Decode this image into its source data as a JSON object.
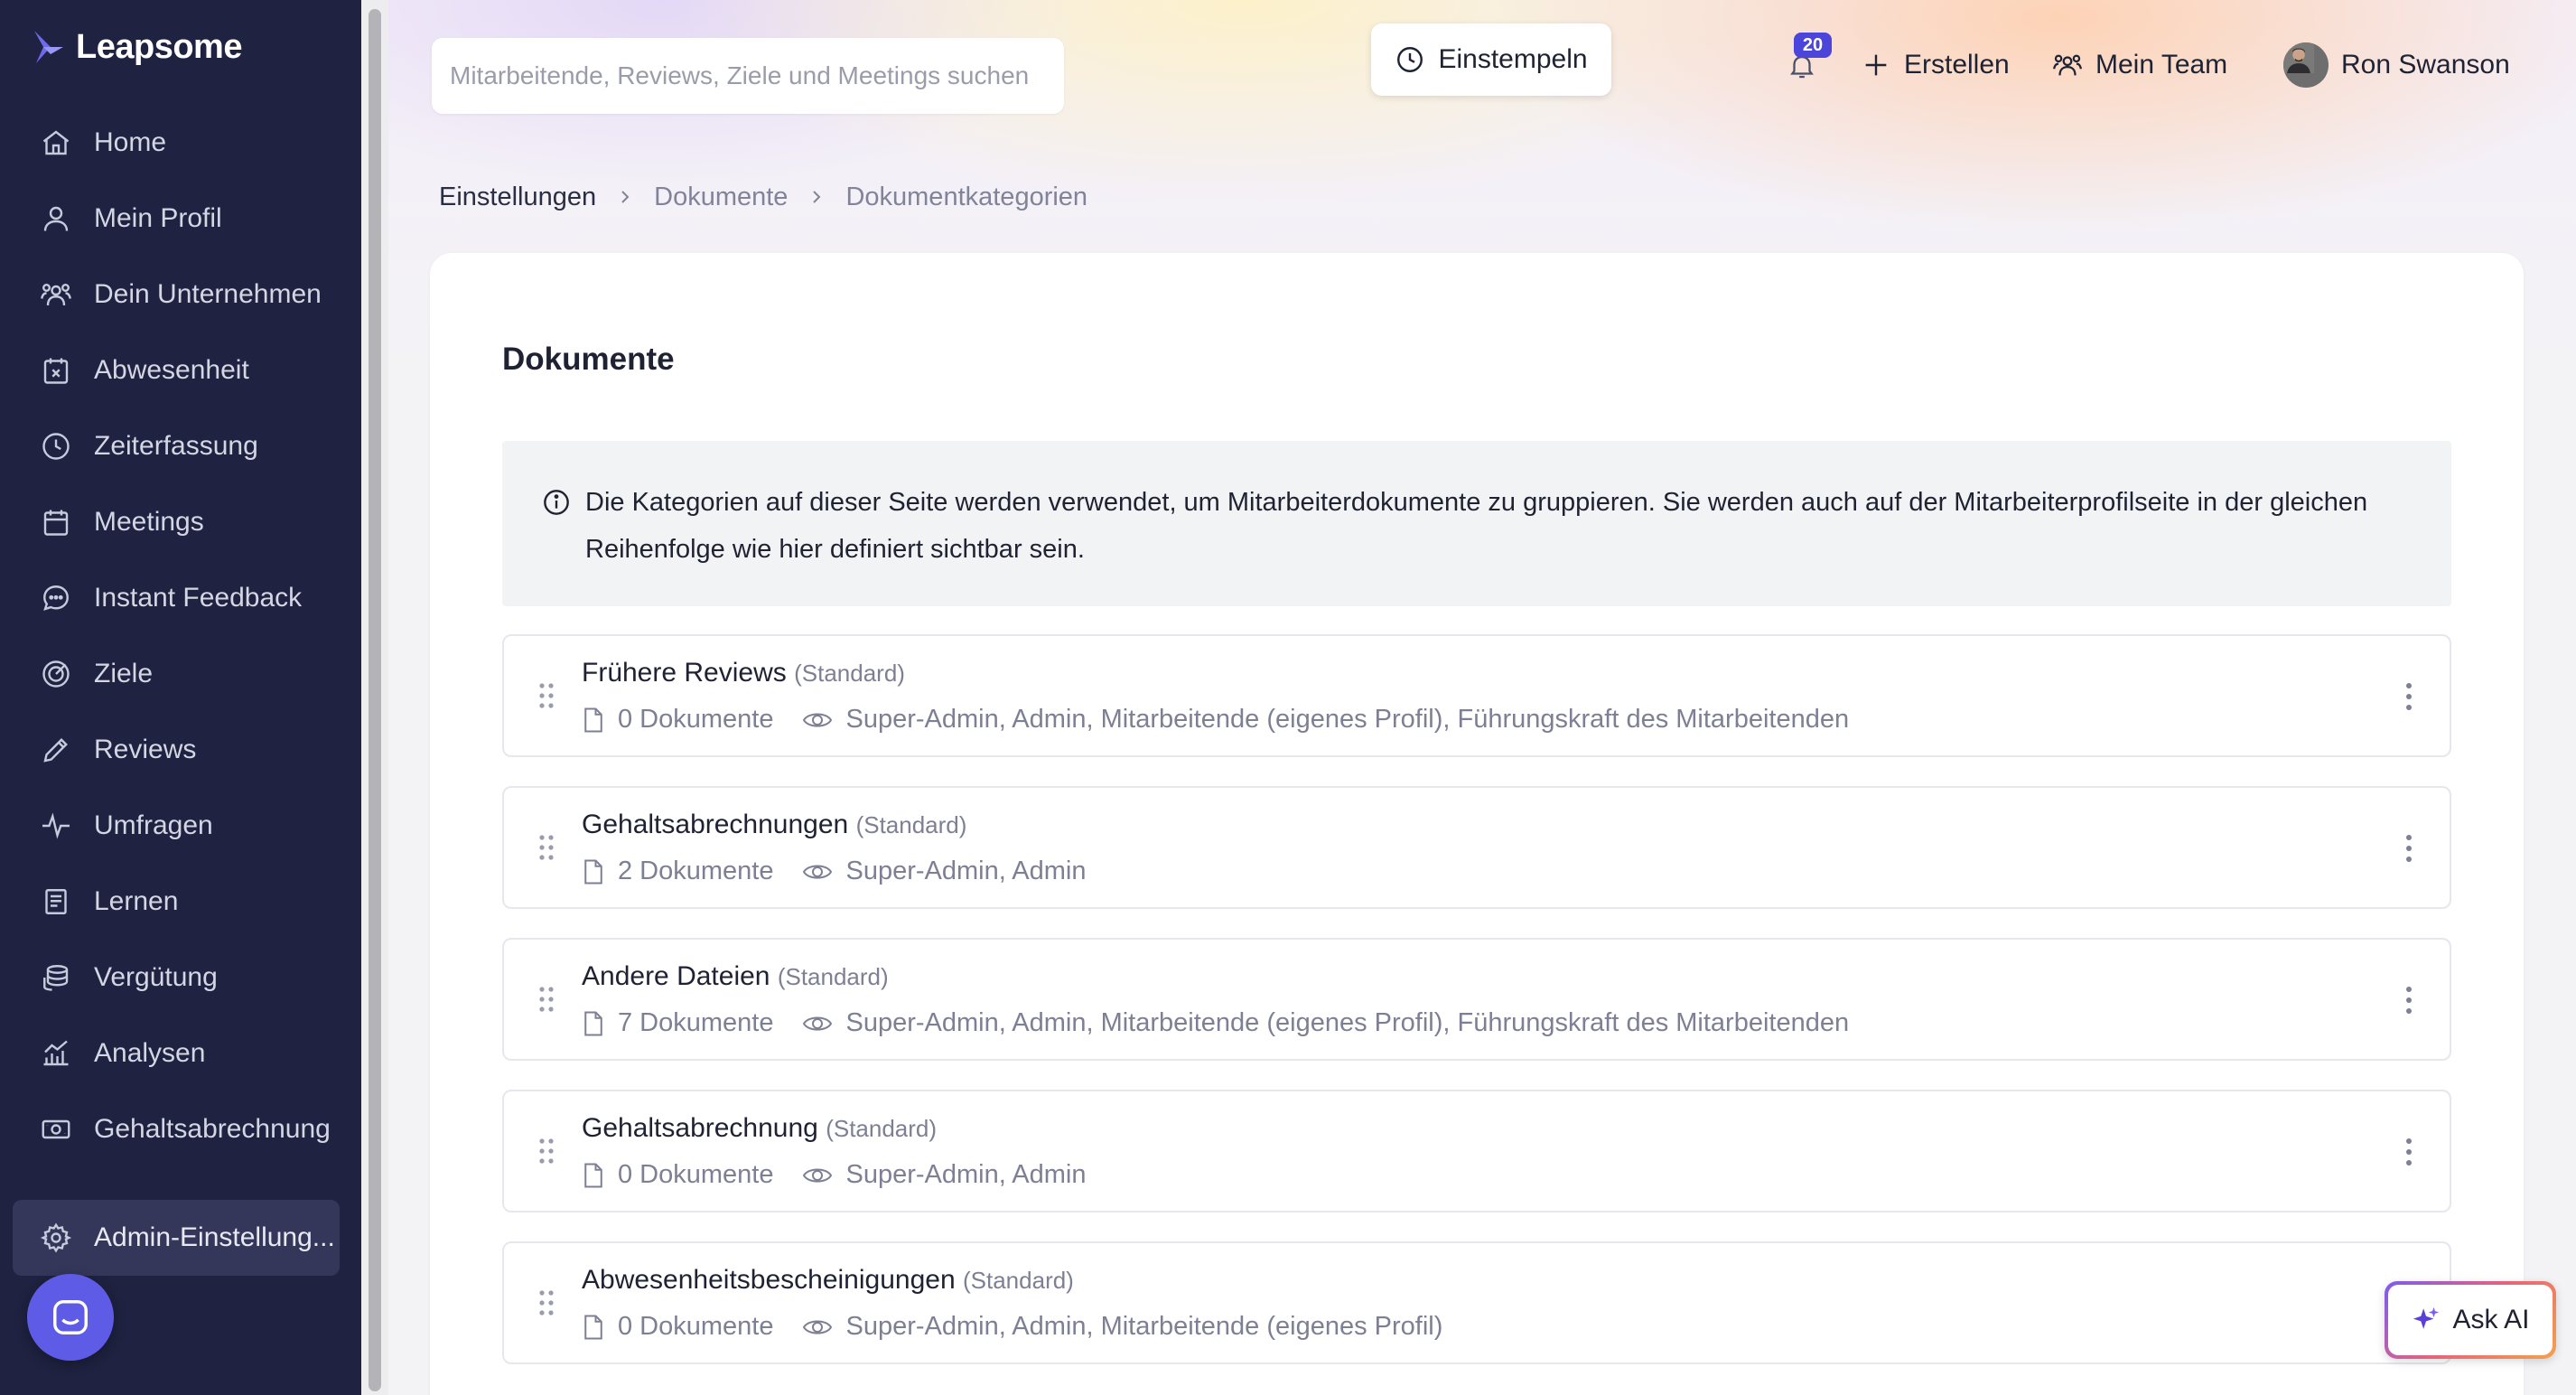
{
  "brand": {
    "name": "Leapsome"
  },
  "sidebar": {
    "items": [
      {
        "label": "Home",
        "icon": "home-icon"
      },
      {
        "label": "Mein Profil",
        "icon": "user-icon"
      },
      {
        "label": "Dein Unternehmen",
        "icon": "users-icon"
      },
      {
        "label": "Abwesenheit",
        "icon": "calendar-x-icon"
      },
      {
        "label": "Zeiterfassung",
        "icon": "clock-icon"
      },
      {
        "label": "Meetings",
        "icon": "calendar-icon"
      },
      {
        "label": "Instant Feedback",
        "icon": "chat-bubble-icon"
      },
      {
        "label": "Ziele",
        "icon": "target-icon"
      },
      {
        "label": "Reviews",
        "icon": "pencil-icon"
      },
      {
        "label": "Umfragen",
        "icon": "pulse-icon"
      },
      {
        "label": "Lernen",
        "icon": "book-icon"
      },
      {
        "label": "Vergütung",
        "icon": "coins-icon"
      },
      {
        "label": "Analysen",
        "icon": "chart-icon"
      },
      {
        "label": "Gehaltsabrechnung",
        "icon": "cash-icon"
      }
    ],
    "admin": {
      "label": "Admin-Einstellung...",
      "icon": "gear-icon"
    }
  },
  "header": {
    "search_placeholder": "Mitarbeitende, Reviews, Ziele und Meetings suchen",
    "clockin_label": "Einstempeln",
    "notifications_count": "20",
    "create_label": "Erstellen",
    "team_label": "Mein Team",
    "user_name": "Ron Swanson"
  },
  "breadcrumb": [
    "Einstellungen",
    "Dokumente",
    "Dokumentkategorien"
  ],
  "card": {
    "title": "Dokumente",
    "info": "Die Kategorien auf dieser Seite werden verwendet, um Mitarbeiterdokumente zu gruppieren. Sie werden auch auf der Mitarbeiterprofilseite in der gleichen Reihenfolge wie hier definiert sichtbar sein."
  },
  "categories": [
    {
      "name": "Frühere Reviews",
      "tag": "(Standard)",
      "count": "0 Dokumente",
      "visibility": "Super-Admin, Admin, Mitarbeitende (eigenes Profil), Führungskraft des Mitarbeitenden"
    },
    {
      "name": "Gehaltsabrechnungen",
      "tag": "(Standard)",
      "count": "2 Dokumente",
      "visibility": "Super-Admin, Admin"
    },
    {
      "name": "Andere Dateien",
      "tag": "(Standard)",
      "count": "7 Dokumente",
      "visibility": "Super-Admin, Admin, Mitarbeitende (eigenes Profil), Führungskraft des Mitarbeitenden"
    },
    {
      "name": "Gehaltsabrechnung",
      "tag": "(Standard)",
      "count": "0 Dokumente",
      "visibility": "Super-Admin, Admin"
    },
    {
      "name": "Abwesenheitsbescheinigungen",
      "tag": "(Standard)",
      "count": "0 Dokumente",
      "visibility": "Super-Admin, Admin, Mitarbeitende (eigenes Profil)"
    }
  ],
  "ask_ai_label": "Ask AI",
  "colors": {
    "sidebar_bg": "#1f2240",
    "accent": "#5e5ce6",
    "badge": "#4b45d9"
  }
}
